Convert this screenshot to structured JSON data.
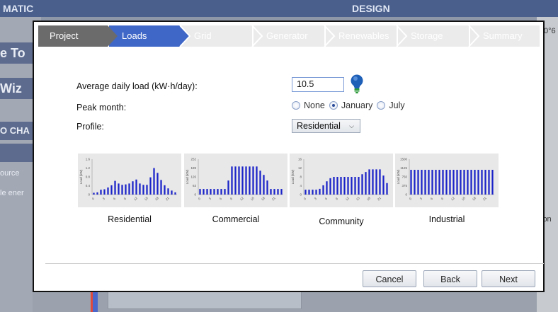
{
  "background": {
    "header_left": "MATIC",
    "header_right": "DESIGN",
    "side_tiles": [
      "e To",
      "Wiz",
      "O CHA"
    ],
    "side_labels": [
      "ource",
      "le ener"
    ],
    "right_top_text": "0°6",
    "right_text": "ion"
  },
  "wizard": {
    "steps": [
      {
        "label": "Project",
        "state": "done"
      },
      {
        "label": "Loads",
        "state": "active"
      },
      {
        "label": "Grid",
        "state": "pending"
      },
      {
        "label": "Generator",
        "state": "pending"
      },
      {
        "label": "Renewables",
        "state": "pending"
      },
      {
        "label": "Storage",
        "state": "pending"
      },
      {
        "label": "Summary",
        "state": "pending"
      }
    ]
  },
  "form": {
    "daily_load_label": "Average daily load (kW·h/day):",
    "daily_load_value": "10.5",
    "peak_month_label": "Peak month:",
    "peak_month_options": [
      "None",
      "January",
      "July"
    ],
    "peak_month_selected": "January",
    "profile_label": "Profile:",
    "profile_value": "Residential"
  },
  "colors": {
    "accent": "#3f67c7",
    "bar": "#1a23c8",
    "bulb": "#1e5fb8"
  },
  "chart_data": [
    {
      "type": "bar",
      "title": "Residential",
      "ylabel": "Load (kW)",
      "yticks": [
        "0",
        "0.4",
        "0.8",
        "1.2",
        "1.6"
      ],
      "ylim": [
        0,
        1.6
      ],
      "categories": [
        "0",
        "1",
        "2",
        "3",
        "4",
        "5",
        "6",
        "7",
        "8",
        "9",
        "10",
        "11",
        "12",
        "13",
        "14",
        "15",
        "16",
        "17",
        "18",
        "19",
        "20",
        "21",
        "22",
        "23"
      ],
      "xticks": [
        "0",
        "3",
        "6",
        "9",
        "12",
        "15",
        "18",
        "21"
      ],
      "values": [
        0.08,
        0.1,
        0.22,
        0.24,
        0.32,
        0.42,
        0.62,
        0.5,
        0.44,
        0.46,
        0.5,
        0.6,
        0.68,
        0.5,
        0.44,
        0.44,
        0.78,
        1.2,
        0.98,
        0.66,
        0.42,
        0.28,
        0.18,
        0.1
      ]
    },
    {
      "type": "bar",
      "title": "Commercial",
      "ylabel": "Load (kW)",
      "yticks": [
        "0",
        "63",
        "126",
        "189",
        "252"
      ],
      "ylim": [
        0,
        252
      ],
      "categories": [
        "0",
        "1",
        "2",
        "3",
        "4",
        "5",
        "6",
        "7",
        "8",
        "9",
        "10",
        "11",
        "12",
        "13",
        "14",
        "15",
        "16",
        "17",
        "18",
        "19",
        "20",
        "21",
        "22",
        "23"
      ],
      "xticks": [
        "0",
        "3",
        "6",
        "9",
        "12",
        "15",
        "18",
        "21"
      ],
      "values": [
        40,
        40,
        40,
        40,
        40,
        40,
        40,
        40,
        100,
        200,
        200,
        200,
        200,
        200,
        200,
        200,
        200,
        170,
        140,
        100,
        40,
        40,
        40,
        40
      ]
    },
    {
      "type": "bar",
      "title": "Community",
      "ylabel": "Load (kW)",
      "yticks": [
        "0",
        "4",
        "8",
        "12",
        "16"
      ],
      "ylim": [
        0,
        16
      ],
      "categories": [
        "0",
        "1",
        "2",
        "3",
        "4",
        "5",
        "6",
        "7",
        "8",
        "9",
        "10",
        "11",
        "12",
        "13",
        "14",
        "15",
        "16",
        "17",
        "18",
        "19",
        "20",
        "21",
        "22",
        "23"
      ],
      "xticks": [
        "0",
        "3",
        "6",
        "9",
        "12",
        "15",
        "18",
        "21"
      ],
      "values": [
        2.2,
        2.2,
        2.2,
        2.2,
        2.6,
        4.2,
        6,
        7.4,
        8,
        8,
        8,
        8,
        8,
        8,
        8,
        8,
        9.2,
        10.2,
        11.4,
        11.4,
        11.4,
        11.4,
        8.6,
        5.2
      ]
    },
    {
      "type": "bar",
      "title": "Industrial",
      "ylabel": "Load (kW)",
      "yticks": [
        "0",
        "375",
        "750",
        "1125",
        "1500"
      ],
      "ylim": [
        0,
        1500
      ],
      "categories": [
        "0",
        "1",
        "2",
        "3",
        "4",
        "5",
        "6",
        "7",
        "8",
        "9",
        "10",
        "11",
        "12",
        "13",
        "14",
        "15",
        "16",
        "17",
        "18",
        "19",
        "20",
        "21",
        "22",
        "23"
      ],
      "xticks": [
        "0",
        "3",
        "6",
        "9",
        "12",
        "15",
        "18",
        "21"
      ],
      "values": [
        1050,
        1050,
        1050,
        1050,
        1050,
        1050,
        1050,
        1050,
        1050,
        1050,
        1050,
        1050,
        1050,
        1050,
        1050,
        1050,
        1050,
        1050,
        1050,
        1050,
        1050,
        1050,
        1050,
        1050
      ]
    }
  ],
  "buttons": {
    "cancel": "Cancel",
    "back": "Back",
    "next": "Next"
  }
}
